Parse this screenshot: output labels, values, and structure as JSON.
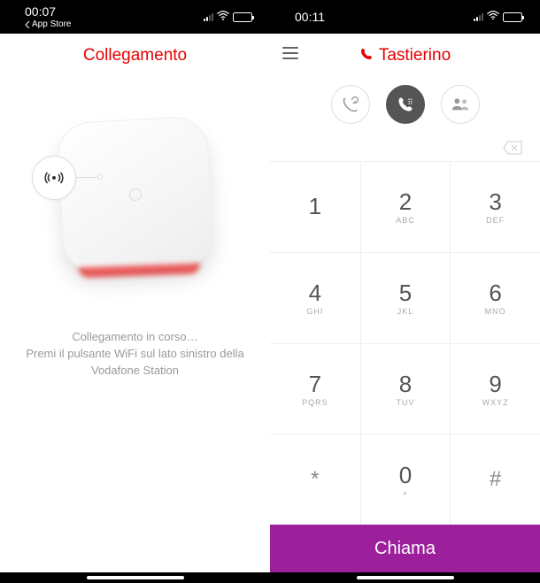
{
  "left": {
    "time": "00:07",
    "back_label": "App Store",
    "title": "Collegamento",
    "desc_line1": "Collegamento in corso…",
    "desc_line2": "Premi il pulsante WiFi sul lato sinistro della",
    "desc_line3": "Vodafone Station"
  },
  "right": {
    "time": "00:11",
    "title": "Tastierino",
    "call_label": "Chiama",
    "keys": [
      {
        "d": "1",
        "l": ""
      },
      {
        "d": "2",
        "l": "ABC"
      },
      {
        "d": "3",
        "l": "DEF"
      },
      {
        "d": "4",
        "l": "GHI"
      },
      {
        "d": "5",
        "l": "JKL"
      },
      {
        "d": "6",
        "l": "MNO"
      },
      {
        "d": "7",
        "l": "PQRS"
      },
      {
        "d": "8",
        "l": "TUV"
      },
      {
        "d": "9",
        "l": "WXYZ"
      },
      {
        "d": "*",
        "l": ""
      },
      {
        "d": "0",
        "l": "+"
      },
      {
        "d": "#",
        "l": ""
      }
    ]
  },
  "colors": {
    "accent_red": "#e60000",
    "call_purple": "#9c1f9c"
  }
}
